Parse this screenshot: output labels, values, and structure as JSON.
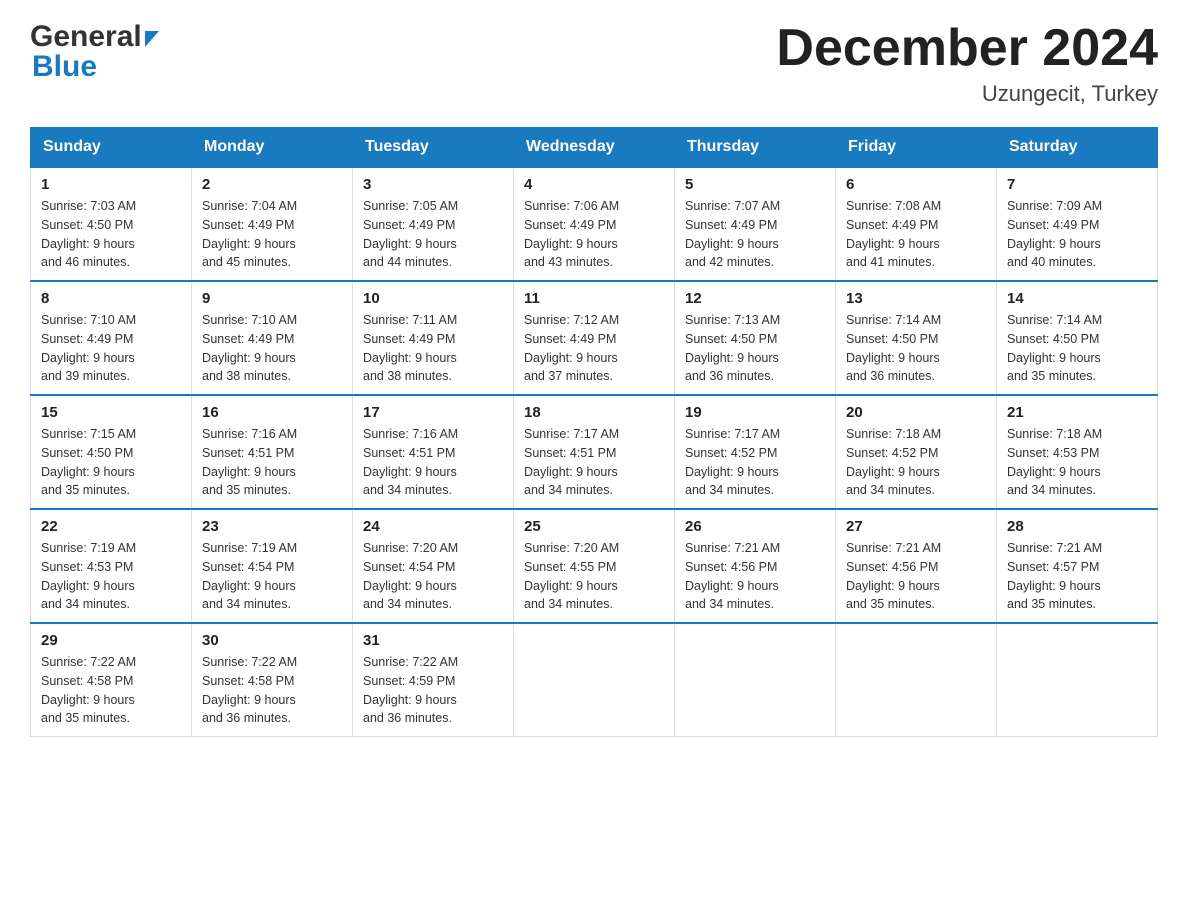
{
  "header": {
    "logo_general": "General",
    "logo_blue": "Blue",
    "month_title": "December 2024",
    "location": "Uzungecit, Turkey"
  },
  "weekdays": [
    "Sunday",
    "Monday",
    "Tuesday",
    "Wednesday",
    "Thursday",
    "Friday",
    "Saturday"
  ],
  "weeks": [
    [
      {
        "day": "1",
        "sunrise": "7:03 AM",
        "sunset": "4:50 PM",
        "daylight": "9 hours and 46 minutes."
      },
      {
        "day": "2",
        "sunrise": "7:04 AM",
        "sunset": "4:49 PM",
        "daylight": "9 hours and 45 minutes."
      },
      {
        "day": "3",
        "sunrise": "7:05 AM",
        "sunset": "4:49 PM",
        "daylight": "9 hours and 44 minutes."
      },
      {
        "day": "4",
        "sunrise": "7:06 AM",
        "sunset": "4:49 PM",
        "daylight": "9 hours and 43 minutes."
      },
      {
        "day": "5",
        "sunrise": "7:07 AM",
        "sunset": "4:49 PM",
        "daylight": "9 hours and 42 minutes."
      },
      {
        "day": "6",
        "sunrise": "7:08 AM",
        "sunset": "4:49 PM",
        "daylight": "9 hours and 41 minutes."
      },
      {
        "day": "7",
        "sunrise": "7:09 AM",
        "sunset": "4:49 PM",
        "daylight": "9 hours and 40 minutes."
      }
    ],
    [
      {
        "day": "8",
        "sunrise": "7:10 AM",
        "sunset": "4:49 PM",
        "daylight": "9 hours and 39 minutes."
      },
      {
        "day": "9",
        "sunrise": "7:10 AM",
        "sunset": "4:49 PM",
        "daylight": "9 hours and 38 minutes."
      },
      {
        "day": "10",
        "sunrise": "7:11 AM",
        "sunset": "4:49 PM",
        "daylight": "9 hours and 38 minutes."
      },
      {
        "day": "11",
        "sunrise": "7:12 AM",
        "sunset": "4:49 PM",
        "daylight": "9 hours and 37 minutes."
      },
      {
        "day": "12",
        "sunrise": "7:13 AM",
        "sunset": "4:50 PM",
        "daylight": "9 hours and 36 minutes."
      },
      {
        "day": "13",
        "sunrise": "7:14 AM",
        "sunset": "4:50 PM",
        "daylight": "9 hours and 36 minutes."
      },
      {
        "day": "14",
        "sunrise": "7:14 AM",
        "sunset": "4:50 PM",
        "daylight": "9 hours and 35 minutes."
      }
    ],
    [
      {
        "day": "15",
        "sunrise": "7:15 AM",
        "sunset": "4:50 PM",
        "daylight": "9 hours and 35 minutes."
      },
      {
        "day": "16",
        "sunrise": "7:16 AM",
        "sunset": "4:51 PM",
        "daylight": "9 hours and 35 minutes."
      },
      {
        "day": "17",
        "sunrise": "7:16 AM",
        "sunset": "4:51 PM",
        "daylight": "9 hours and 34 minutes."
      },
      {
        "day": "18",
        "sunrise": "7:17 AM",
        "sunset": "4:51 PM",
        "daylight": "9 hours and 34 minutes."
      },
      {
        "day": "19",
        "sunrise": "7:17 AM",
        "sunset": "4:52 PM",
        "daylight": "9 hours and 34 minutes."
      },
      {
        "day": "20",
        "sunrise": "7:18 AM",
        "sunset": "4:52 PM",
        "daylight": "9 hours and 34 minutes."
      },
      {
        "day": "21",
        "sunrise": "7:18 AM",
        "sunset": "4:53 PM",
        "daylight": "9 hours and 34 minutes."
      }
    ],
    [
      {
        "day": "22",
        "sunrise": "7:19 AM",
        "sunset": "4:53 PM",
        "daylight": "9 hours and 34 minutes."
      },
      {
        "day": "23",
        "sunrise": "7:19 AM",
        "sunset": "4:54 PM",
        "daylight": "9 hours and 34 minutes."
      },
      {
        "day": "24",
        "sunrise": "7:20 AM",
        "sunset": "4:54 PM",
        "daylight": "9 hours and 34 minutes."
      },
      {
        "day": "25",
        "sunrise": "7:20 AM",
        "sunset": "4:55 PM",
        "daylight": "9 hours and 34 minutes."
      },
      {
        "day": "26",
        "sunrise": "7:21 AM",
        "sunset": "4:56 PM",
        "daylight": "9 hours and 34 minutes."
      },
      {
        "day": "27",
        "sunrise": "7:21 AM",
        "sunset": "4:56 PM",
        "daylight": "9 hours and 35 minutes."
      },
      {
        "day": "28",
        "sunrise": "7:21 AM",
        "sunset": "4:57 PM",
        "daylight": "9 hours and 35 minutes."
      }
    ],
    [
      {
        "day": "29",
        "sunrise": "7:22 AM",
        "sunset": "4:58 PM",
        "daylight": "9 hours and 35 minutes."
      },
      {
        "day": "30",
        "sunrise": "7:22 AM",
        "sunset": "4:58 PM",
        "daylight": "9 hours and 36 minutes."
      },
      {
        "day": "31",
        "sunrise": "7:22 AM",
        "sunset": "4:59 PM",
        "daylight": "9 hours and 36 minutes."
      },
      null,
      null,
      null,
      null
    ]
  ],
  "labels": {
    "sunrise": "Sunrise:",
    "sunset": "Sunset:",
    "daylight": "Daylight:"
  }
}
